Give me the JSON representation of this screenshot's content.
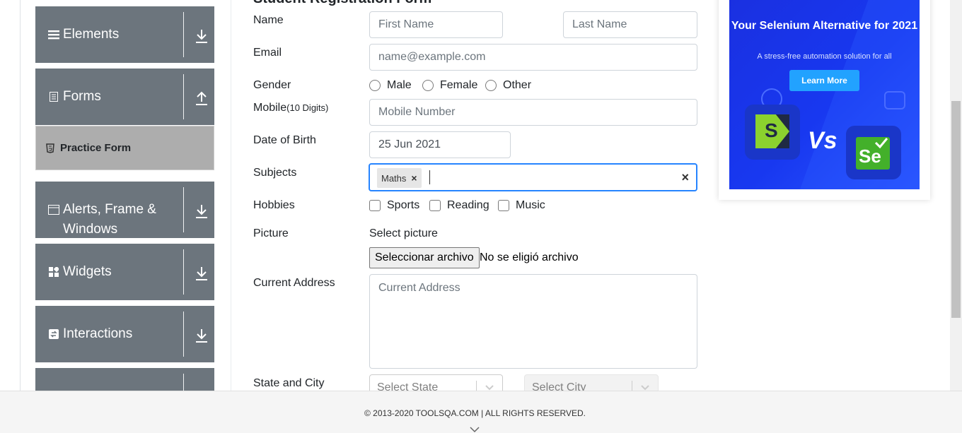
{
  "sidebar": {
    "groups": [
      {
        "label": "Elements",
        "icon": "menu-icon",
        "arrow": "download-arrow-icon"
      },
      {
        "label": "Forms",
        "icon": "document-icon",
        "arrow": "upload-arrow-icon"
      },
      {
        "label": "Alerts, Frame & Windows",
        "icon": "window-icon",
        "arrow": "download-arrow-icon"
      },
      {
        "label": "Widgets",
        "icon": "widgets-icon",
        "arrow": "download-arrow-icon"
      },
      {
        "label": "Interactions",
        "icon": "interactions-icon",
        "arrow": "download-arrow-icon"
      }
    ],
    "active_item": {
      "label": "Practice Form",
      "icon": "html-icon"
    }
  },
  "form": {
    "title": "Student Registration Form",
    "name_label": "Name",
    "first_name_placeholder": "First Name",
    "last_name_placeholder": "Last Name",
    "email_label": "Email",
    "email_placeholder": "name@example.com",
    "gender_label": "Gender",
    "gender_options": [
      "Male",
      "Female",
      "Other"
    ],
    "mobile_label": "Mobile",
    "mobile_hint": "(10 Digits)",
    "mobile_placeholder": "Mobile Number",
    "dob_label": "Date of Birth",
    "dob_value": "25 Jun 2021",
    "subjects_label": "Subjects",
    "subjects_chip": "Maths",
    "chip_remove": "×",
    "clear_all": "×",
    "hobbies_label": "Hobbies",
    "hobbies": [
      "Sports",
      "Reading",
      "Music"
    ],
    "picture_label": "Picture",
    "select_picture": "Select picture",
    "file_button": "Seleccionar archivo",
    "file_status": "No se eligió archivo",
    "address_label": "Current Address",
    "address_placeholder": "Current Address",
    "state_city_label": "State and City",
    "state_placeholder": "Select State",
    "city_placeholder": "Select City"
  },
  "ad": {
    "title": "Your Selenium Alternative for 2021",
    "subtitle": "A stress-free automation solution for all",
    "button": "Learn More",
    "vs": "Vs",
    "logo_left": "S",
    "logo_right": "Se"
  },
  "footer": {
    "copyright": "© 2013-2020 TOOLSQA.COM | ALL RIGHTS RESERVED."
  },
  "colors": {
    "sidebar_group": "#6c757d",
    "active_item": "#adadad",
    "focus_border": "#2684ff",
    "ad_blue": "#1838f0"
  }
}
